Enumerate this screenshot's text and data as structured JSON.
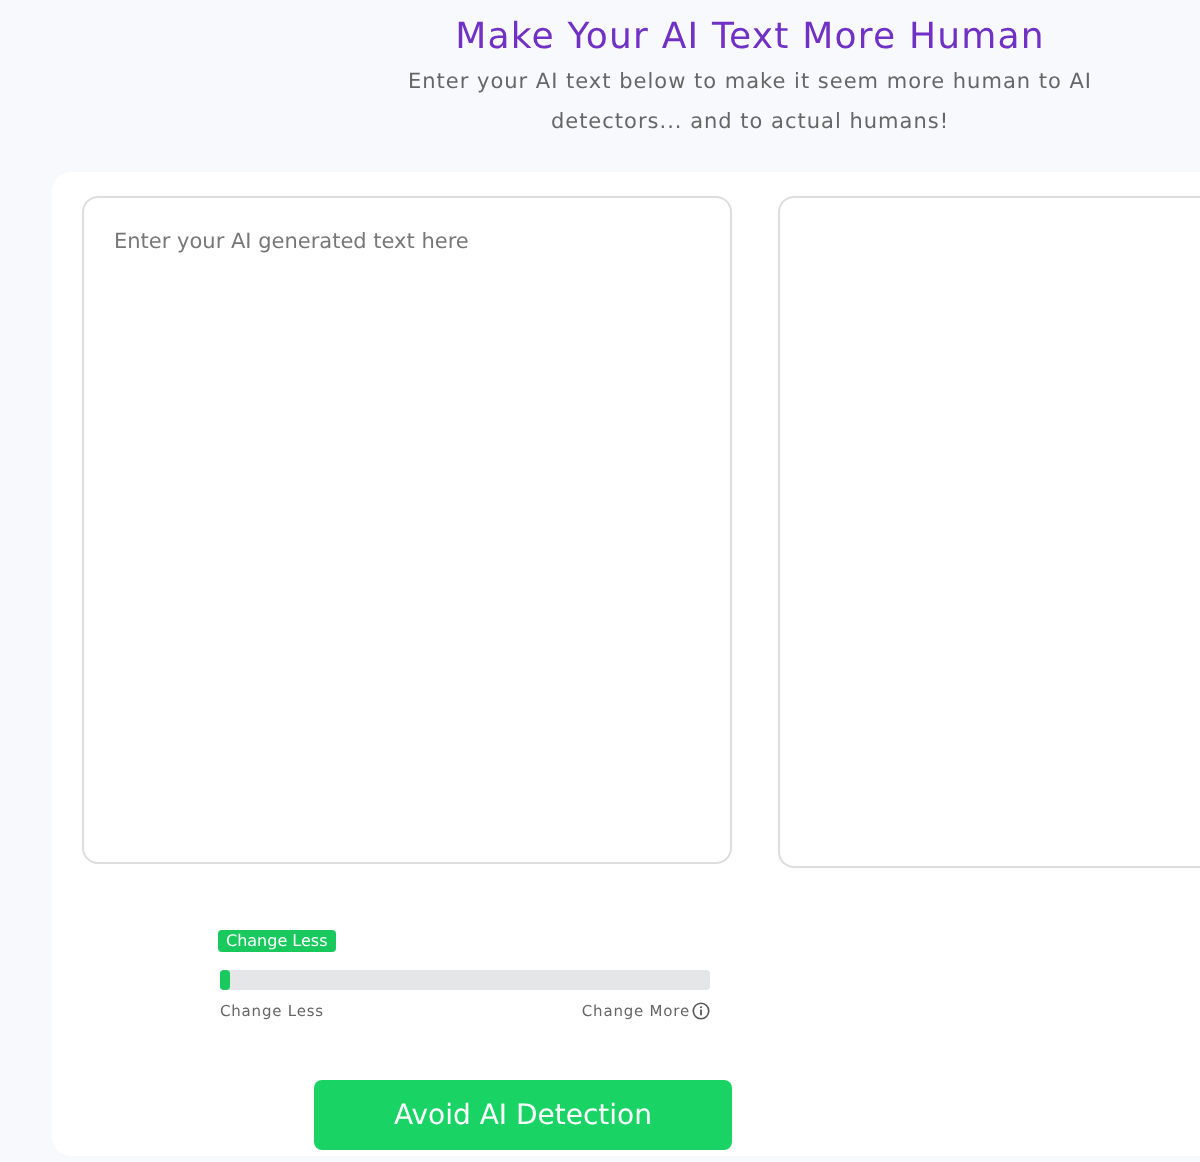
{
  "header": {
    "title": "Make Your AI Text More Human",
    "subtitle": "Enter your AI text below to make it seem more human to AI detectors... and to actual humans!"
  },
  "input": {
    "placeholder": "Enter your AI generated text here"
  },
  "slider": {
    "tooltip": "Change Less",
    "level": 0.02,
    "min_label": "Change Less",
    "max_label": "Change More"
  },
  "button": {
    "label": "Avoid AI Detection"
  }
}
